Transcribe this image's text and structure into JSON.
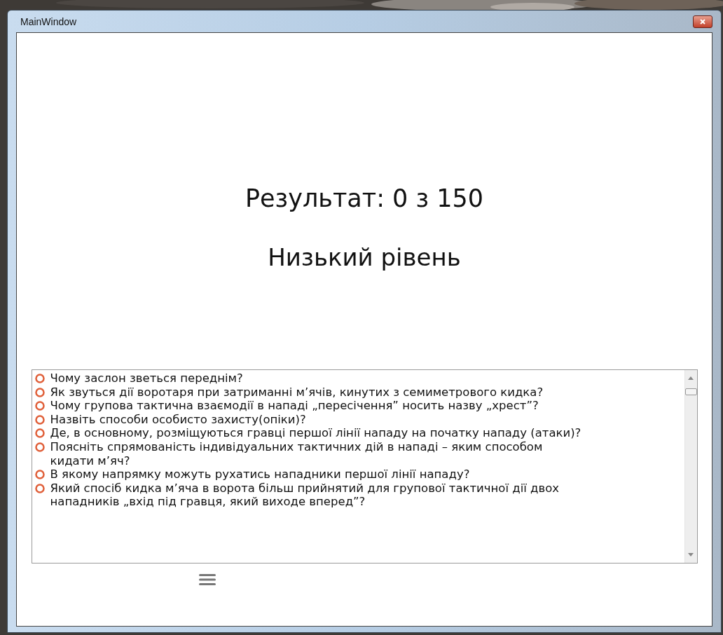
{
  "window": {
    "title": "MainWindow"
  },
  "result": "Результат: 0 з 150",
  "level_text": "Низький рівень",
  "questions": [
    {
      "text": "Чому заслон зветься переднім?",
      "selected": false
    },
    {
      "text": "Як звуться дії воротаря при затриманні м’ячів, кинутих з семиметрового кидка?",
      "selected": false
    },
    {
      "text": "Чому групова тактична взаємодії в нападі „пересічення” носить назву „хрест”?",
      "selected": false
    },
    {
      "text": "Назвіть способи особисто захисту(опіки)?",
      "selected": false
    },
    {
      "text": "Де, в основному, розміщуються гравці першої лінії нападу на початку нападу (атаки)?",
      "selected": false
    },
    {
      "text": "Поясніть спрямованість індивідуальних тактичних дій в нападі – яким способом кидати м’яч?",
      "selected": false
    },
    {
      "text": "В якому напрямку можуть рухатись нападники першої лінії нападу?",
      "selected": false
    },
    {
      "text": "Який спосіб кидка м’яча в ворота більш прийнятий для групової тактичної дії двох нападників „вхід під гравця, який виходе вперед”?",
      "selected": false
    }
  ]
}
